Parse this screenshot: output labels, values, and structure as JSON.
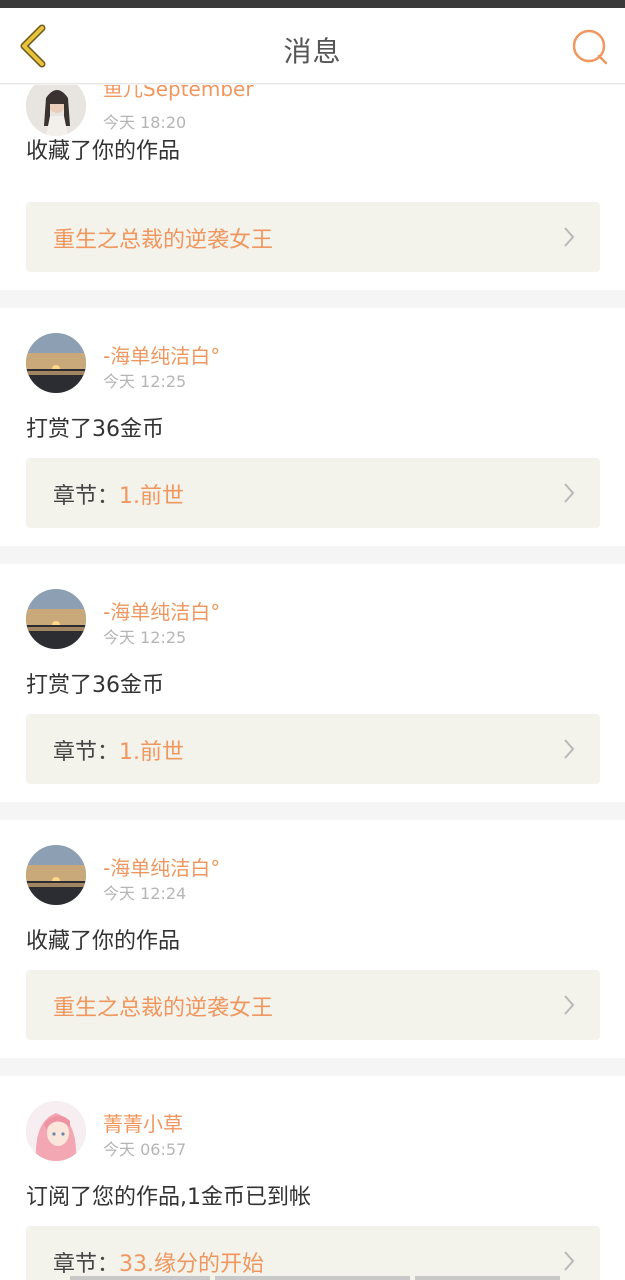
{
  "nav": {
    "title": "消息"
  },
  "messages": [
    {
      "user": "鱼儿September",
      "time": "今天 18:20",
      "action": "收藏了你的作品",
      "link_prefix": "",
      "link_text": "重生之总裁的逆袭女王",
      "avatar_icon": "girl-photo-avatar"
    },
    {
      "user": "-海单纯洁白°",
      "time": "今天 12:25",
      "action": "打赏了36金币",
      "link_prefix": "章节：",
      "link_text": "1.前世",
      "avatar_icon": "sunset-avatar"
    },
    {
      "user": "-海单纯洁白°",
      "time": "今天 12:25",
      "action": "打赏了36金币",
      "link_prefix": "章节：",
      "link_text": "1.前世",
      "avatar_icon": "sunset-avatar"
    },
    {
      "user": "-海单纯洁白°",
      "time": "今天 12:24",
      "action": "收藏了你的作品",
      "link_prefix": "",
      "link_text": "重生之总裁的逆袭女王",
      "avatar_icon": "sunset-avatar"
    },
    {
      "user": "菁菁小草",
      "time": "今天 06:57",
      "action": "订阅了您的作品,1金币已到帐",
      "link_prefix": "章节：",
      "link_text": "33.缘分的开始",
      "avatar_icon": "anime-girl-avatar"
    }
  ],
  "colors": {
    "accent": "#f0975f",
    "back_icon": "#e8c23a",
    "link_box_bg": "#f3f3ec",
    "page_bg": "#f5f5f5"
  }
}
